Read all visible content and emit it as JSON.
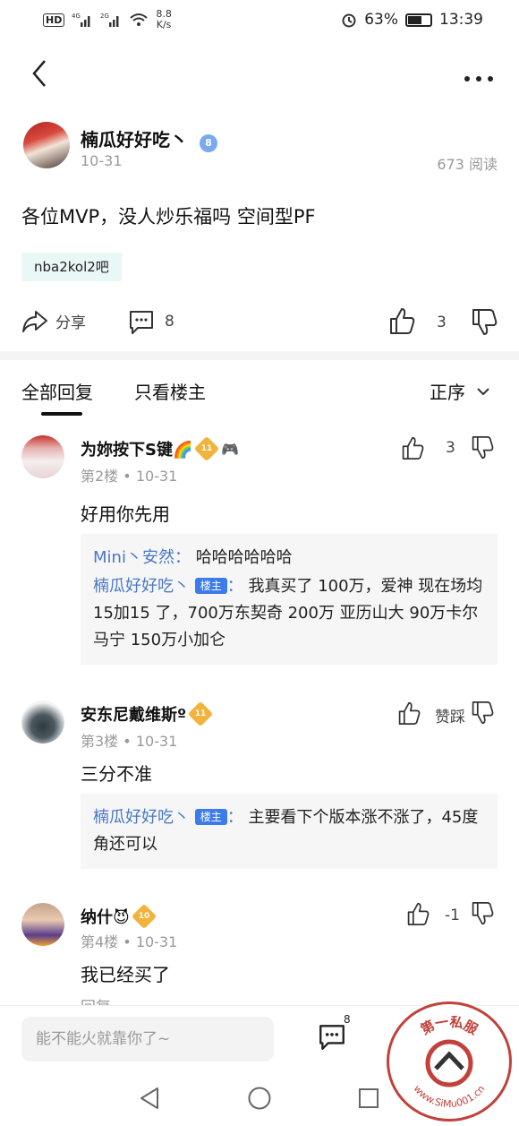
{
  "status_bar": {
    "left_icons": [
      "hd-icon",
      "signal-4g-icon",
      "signal-2g-icon",
      "wifi-icon"
    ],
    "network_speed": "8.8",
    "network_speed_unit": "K/s",
    "battery_percent": "63%",
    "battery_level": 0.63,
    "time": "13:39"
  },
  "post": {
    "author": "楠瓜好好吃丶",
    "author_level": "8",
    "date": "10-31",
    "reads": "673 阅读",
    "title": "各位MVP，没人炒乐福吗 空间型PF",
    "forum_tag": "nba2kol2吧",
    "share_label": "分享",
    "comment_count": "8",
    "like_count": "3"
  },
  "tabs": {
    "all": "全部回复",
    "host_only": "只看楼主",
    "sort": "正序"
  },
  "replies": [
    {
      "name": "为妳按下S键🌈",
      "badge": "11",
      "floor": "第2楼",
      "date": "10-31",
      "body": "好用你先用",
      "like_count": "3",
      "quotes": [
        {
          "name": "Mini丶安然",
          "sep": "：",
          "text": "哈哈哈哈哈哈"
        },
        {
          "name": "楠瓜好好吃丶",
          "host_tag": "楼主",
          "sep": "：",
          "text": "我真买了 100万，爱神 现在场均15加15 了，700万东契奇 200万 亚历山大 90万卡尔马宁 150万小加仑"
        }
      ]
    },
    {
      "name": "安东尼戴维斯º",
      "badge": "11",
      "floor": "第3楼",
      "date": "10-31",
      "body": "三分不准",
      "like_label": "赞踩",
      "quotes": [
        {
          "name": "楠瓜好好吃丶",
          "host_tag": "楼主",
          "sep": "：",
          "text": "主要看下个版本涨不涨了，45度角还可以"
        }
      ]
    },
    {
      "name": "纳什😈",
      "badge": "10",
      "floor": "第4楼",
      "date": "10-31",
      "body": "我已经买了",
      "like_count": "-1",
      "reply_label": "回复"
    }
  ],
  "bottom": {
    "placeholder": "能不能火就靠你了~",
    "comment_badge": "8"
  },
  "watermark": {
    "text": "第一私服",
    "url": "www.SiMu001.cn"
  },
  "colors": {
    "accent_blue": "#4a77c9",
    "host_tag_blue": "#3d7be8",
    "tag_bg": "#e9f7f6",
    "watermark_red": "#c2413a"
  }
}
